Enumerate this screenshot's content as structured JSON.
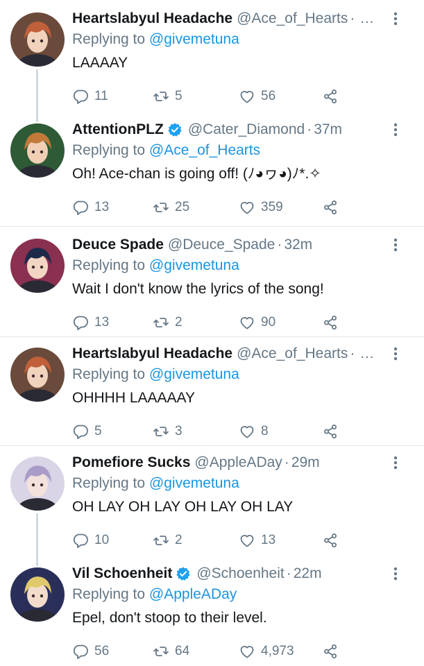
{
  "tweets": [
    {
      "name": "Heartslabyul Headache",
      "handle": "@Ace_of_Hearts",
      "time": "",
      "truncated": "…",
      "verified": false,
      "replying_prefix": "Replying to",
      "replying_to": "@givemetuna",
      "text": "LAAAAY",
      "replies": "11",
      "retweets": "5",
      "likes": "56",
      "avatar_colors": {
        "bg": "#6a4a3a",
        "hair": "#c0603a",
        "skin": "#f1d3bd"
      }
    },
    {
      "name": "AttentionPLZ",
      "handle": "@Cater_Diamond",
      "time": "37m",
      "truncated": "",
      "verified": true,
      "replying_prefix": "Replying to",
      "replying_to": "@Ace_of_Hearts",
      "text": "Oh! Ace-chan is going off! (ﾉ◕ヮ◕)ﾉ*.✧",
      "replies": "13",
      "retweets": "25",
      "likes": "359",
      "avatar_colors": {
        "bg": "#2f5a36",
        "hair": "#c27a3a",
        "skin": "#f0cfb5"
      }
    },
    {
      "name": "Deuce Spade",
      "handle": "@Deuce_Spade",
      "time": "32m",
      "truncated": "",
      "verified": false,
      "replying_prefix": "Replying to",
      "replying_to": "@givemetuna",
      "text": "Wait I don't know the lyrics of the song!",
      "replies": "13",
      "retweets": "2",
      "likes": "90",
      "avatar_colors": {
        "bg": "#8a3050",
        "hair": "#1d2a4a",
        "skin": "#f2d6c4"
      }
    },
    {
      "name": "Heartslabyul Headache",
      "handle": "@Ace_of_Hearts",
      "time": "",
      "truncated": "…",
      "verified": false,
      "replying_prefix": "Replying to",
      "replying_to": "@givemetuna",
      "text": "OHHHH LAAAAAY",
      "replies": "5",
      "retweets": "3",
      "likes": "8",
      "avatar_colors": {
        "bg": "#6a4a3a",
        "hair": "#c0603a",
        "skin": "#f1d3bd"
      }
    },
    {
      "name": "Pomefiore Sucks",
      "handle": "@AppleADay",
      "time": "29m",
      "truncated": "",
      "verified": false,
      "replying_prefix": "Replying to",
      "replying_to": "@givemetuna",
      "text": "OH LAY OH LAY OH LAY OH LAY",
      "replies": "10",
      "retweets": "2",
      "likes": "13",
      "avatar_colors": {
        "bg": "#d9d4e6",
        "hair": "#a99cc8",
        "skin": "#f3e2dc"
      }
    },
    {
      "name": "Vil Schoenheit",
      "handle": "@Schoenheit",
      "time": "22m",
      "truncated": "",
      "verified": true,
      "replying_prefix": "Replying to",
      "replying_to": "@AppleADay",
      "text": "Epel, don't stoop to their level.",
      "replies": "56",
      "retweets": "64",
      "likes": "4,973",
      "avatar_colors": {
        "bg": "#2a2f5a",
        "hair": "#e0c96a",
        "skin": "#f3dccb"
      }
    }
  ],
  "colors": {
    "link": "#1b95e0",
    "muted": "#657786",
    "verified": "#1da1f2",
    "thread_line": "#cfd9de",
    "divider": "#e1e8ed"
  }
}
